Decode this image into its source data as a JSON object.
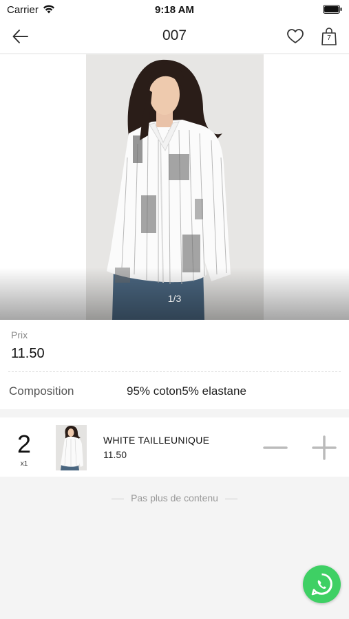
{
  "status_bar": {
    "carrier": "Carrier",
    "time": "9:18 AM",
    "icons": [
      "wifi-icon",
      "battery-icon"
    ]
  },
  "nav": {
    "title": "007",
    "back_icon": "arrow-left-icon",
    "favorite_icon": "heart-icon",
    "bag_icon": "shopping-bag-icon",
    "bag_count": "7"
  },
  "gallery": {
    "indicator": "1/3"
  },
  "product": {
    "price_label": "Prix",
    "price": "11.50",
    "composition_label": "Composition",
    "composition_value": "95% coton5% elastane"
  },
  "cart_item": {
    "quantity": "2",
    "multiplier": "x1",
    "name": "WHITE TAILLEUNIQUE",
    "price": "11.50",
    "minus_icon": "minus-icon",
    "plus_icon": "plus-icon"
  },
  "footer": {
    "no_more_content": "Pas plus de contenu",
    "whatsapp_icon": "whatsapp-icon"
  },
  "colors": {
    "whatsapp_green": "#3ed064",
    "background": "#f4f4f4"
  }
}
